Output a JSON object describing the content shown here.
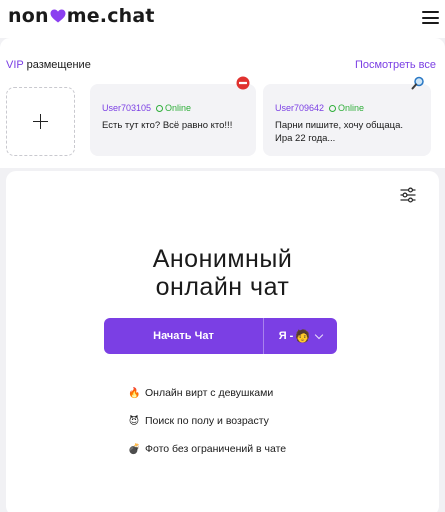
{
  "header": {
    "logo_left": "non",
    "logo_right": "me.chat",
    "heart_color": "#8b3ff0",
    "menu_icon": "hamburger-icon"
  },
  "vip": {
    "title_accent": "VIP",
    "title_rest": "размещение",
    "view_all": "Посмотреть все",
    "add_icon": "plus-icon",
    "cards": [
      {
        "user": "User703105",
        "status": "Online",
        "message": "Есть тут кто? Всё равно кто!!!",
        "badge_icon": "no-entry-icon"
      },
      {
        "user": "User709642",
        "status": "Online",
        "message": "Парни пишите, хочу общаца. Ира 22 года...",
        "badge_icon": "magnifier-icon"
      }
    ]
  },
  "main": {
    "filter_icon": "sliders-icon",
    "title_line1": "Анонимный",
    "title_line2": "онлайн чат",
    "start_button": "Начать Чат",
    "gender_label": "Я -",
    "gender_emoji": "🧑",
    "features": [
      {
        "icon": "🔥",
        "text": "Онлайн вирт с девушками"
      },
      {
        "icon": "😈",
        "text": "Поиск по полу и возрасту"
      },
      {
        "icon": "💣",
        "text": "Фото без ограничений в чате"
      }
    ]
  },
  "colors": {
    "accent": "#7b3fe4",
    "online": "#2fae3a",
    "background": "#f1f1f4"
  }
}
